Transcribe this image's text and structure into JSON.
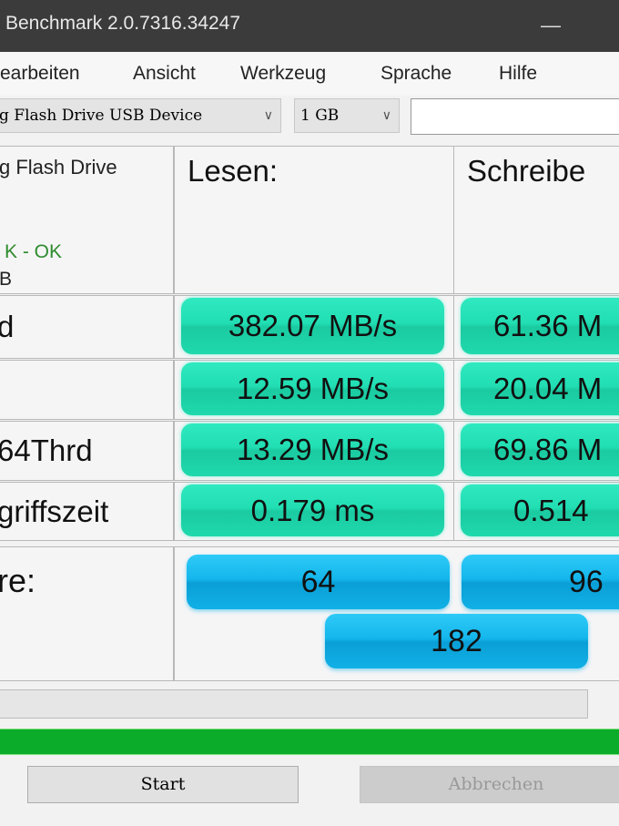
{
  "window": {
    "title": "Benchmark 2.0.7316.34247",
    "minimize_icon": "minimize-icon"
  },
  "menu": [
    "earbeiten",
    "Ansicht",
    "Werkzeug",
    "Sprache",
    "Hilfe"
  ],
  "toolbar": {
    "drive": "g Flash Drive USB Device",
    "size": "1 GB",
    "text": ""
  },
  "info": {
    "name": "g Flash Drive",
    "status": "K - OK",
    "size": "B",
    "status_color": "#2e8b2e"
  },
  "columns": {
    "read": "Lesen:",
    "write": "Schreibe"
  },
  "rows": [
    {
      "label": "d",
      "read": "382.07 MB/s",
      "write": "61.36 M"
    },
    {
      "label": "",
      "read": "12.59 MB/s",
      "write": "20.04 M"
    },
    {
      "label": "64Thrd",
      "read": "13.29 MB/s",
      "write": "69.86 M"
    },
    {
      "label": "griffszeit",
      "read": "0.179 ms",
      "write": "0.514"
    }
  ],
  "score": {
    "label": "re:",
    "read": "64",
    "write": "96",
    "total": "182"
  },
  "progress": {
    "value": 0,
    "green_value": 100,
    "color": "#0aac2a"
  },
  "buttons": {
    "start": "Start",
    "cancel": "Abbrechen"
  }
}
